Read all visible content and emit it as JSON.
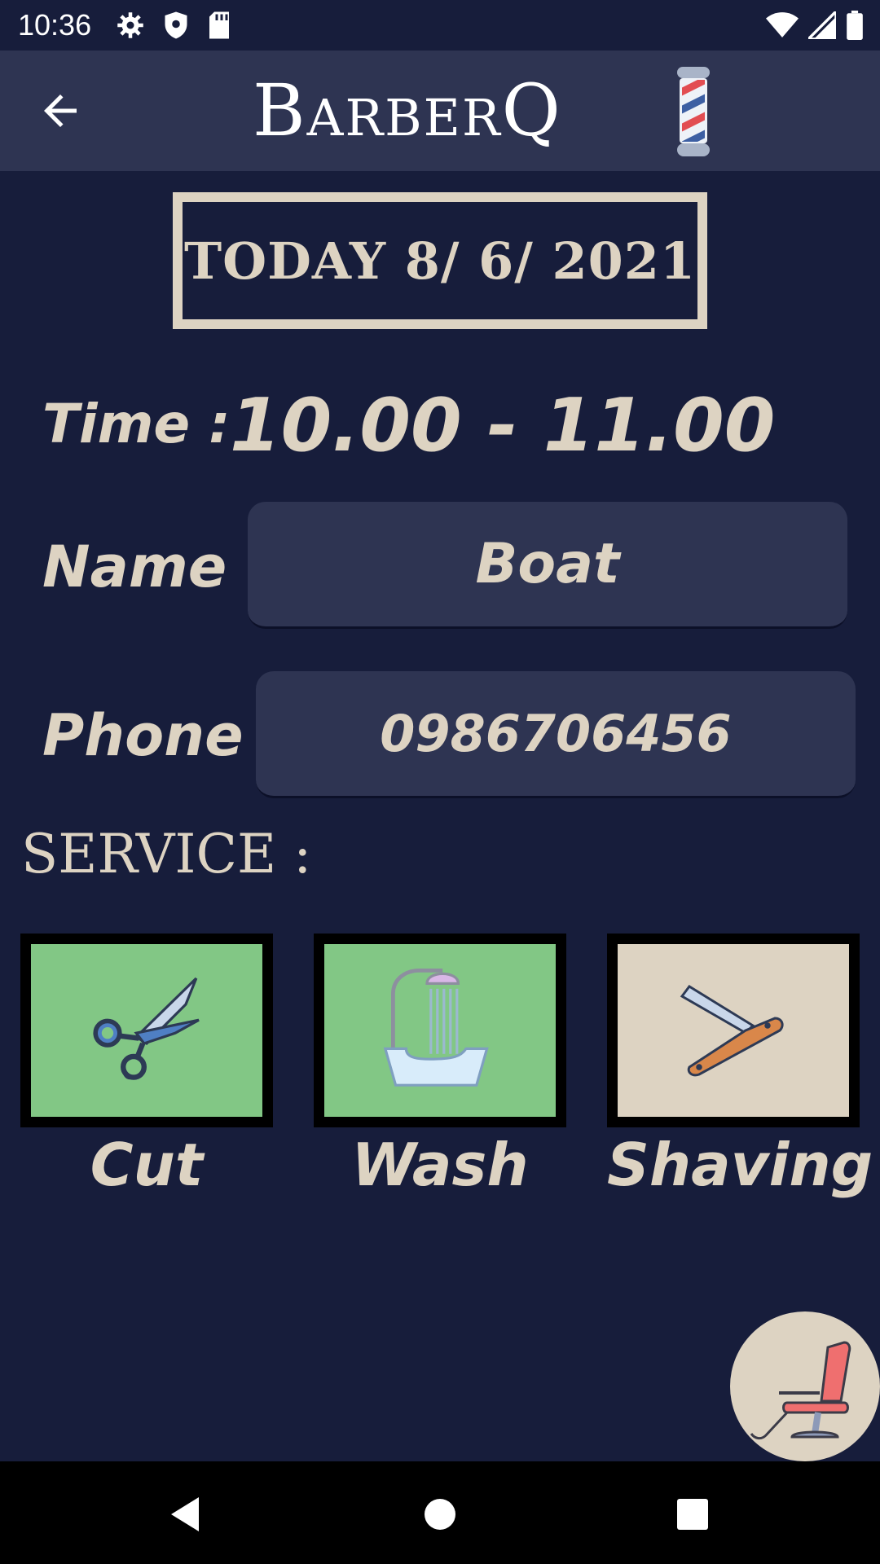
{
  "status": {
    "time": "10:36"
  },
  "appbar": {
    "brand": "BarberQ"
  },
  "date_header": "TODAY 8/ 6/ 2021",
  "form": {
    "time_label": "Time :",
    "time_value": "10.00 - 11.00",
    "name_label": "Name :",
    "name_value": "Boat",
    "phone_label": "Phone :",
    "phone_value": "0986706456"
  },
  "services": {
    "title": "SERVICE :",
    "items": [
      {
        "label": "Cut",
        "icon": "scissors-icon",
        "bg": "#82c785"
      },
      {
        "label": "Wash",
        "icon": "hair-wash-icon",
        "bg": "#82c785"
      },
      {
        "label": "Shaving",
        "icon": "razor-icon",
        "bg": "#ddd3c2"
      }
    ]
  },
  "colors": {
    "background": "#171d3b",
    "appbar": "#2e3452",
    "text": "#ddd3c2",
    "selected": "#82c785"
  }
}
